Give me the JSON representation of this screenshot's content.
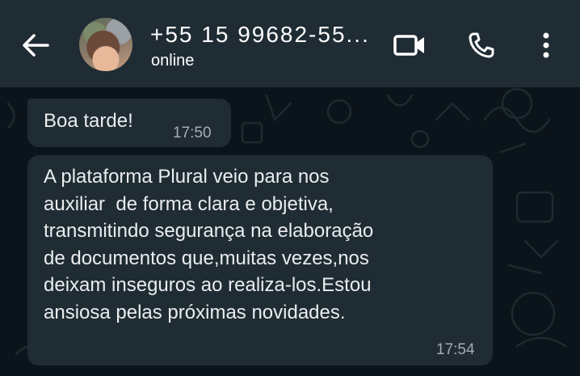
{
  "header": {
    "contact_name": "+55 15 99682-55...",
    "status": "online",
    "back_icon": "arrow-back-icon",
    "video_icon": "video-call-icon",
    "call_icon": "phone-icon",
    "more_icon": "more-vertical-icon"
  },
  "messages": [
    {
      "text": "Boa tarde!",
      "time": "17:50"
    },
    {
      "text": "A plataforma Plural veio para nos\nauxiliar  de forma clara e objetiva,\ntransmitindo segurança na elaboração\nde documentos que,muitas vezes,nos\ndeixam inseguros ao realiza-los.Estou\nansiosa pelas próximas novidades.",
      "time": "17:54"
    }
  ],
  "colors": {
    "header_bg": "#1f2c34",
    "chat_bg": "#0b141a",
    "bubble_bg": "#202c33",
    "text": "#e9edef",
    "timestamp": "#a3acb1"
  }
}
